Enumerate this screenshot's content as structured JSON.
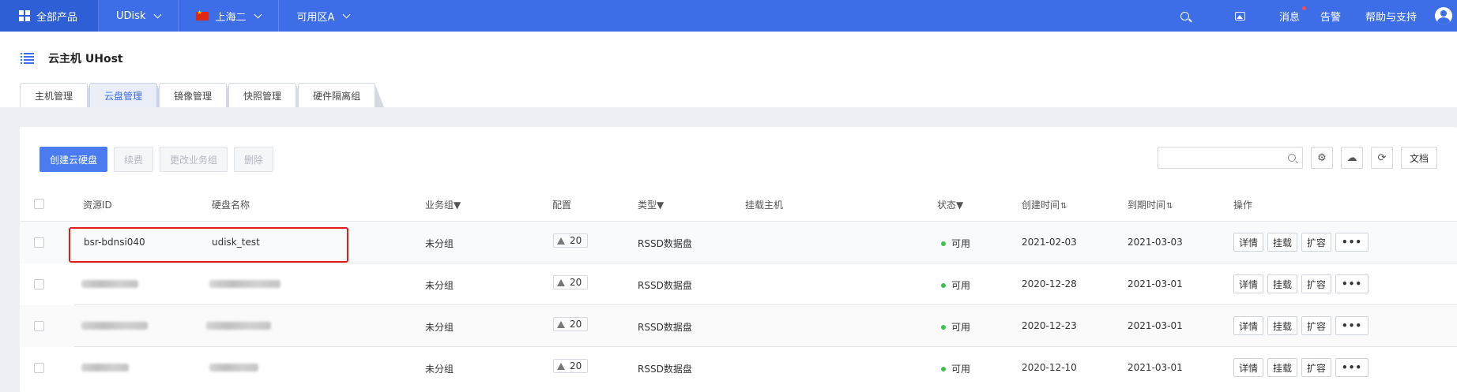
{
  "topbar": {
    "all_products": "全部产品",
    "product": "UDisk",
    "region": "上海二",
    "zone": "可用区A",
    "messages": "消息",
    "alerts": "告警",
    "help": "帮助与支持"
  },
  "header": {
    "title": "云主机 UHost",
    "tabs": [
      {
        "label": "主机管理"
      },
      {
        "label": "云盘管理"
      },
      {
        "label": "镜像管理"
      },
      {
        "label": "快照管理"
      },
      {
        "label": "硬件隔离组"
      }
    ]
  },
  "toolbar": {
    "create": "创建云硬盘",
    "renew": "续费",
    "change_group": "更改业务组",
    "delete": "删除",
    "docs": "文档"
  },
  "table": {
    "headers": {
      "resource_id": "资源ID",
      "disk_name": "硬盘名称",
      "business_group": "业务组▼",
      "config": "配置",
      "type": "类型▼",
      "host": "挂载主机",
      "status": "状态▼",
      "created": "创建时间",
      "expires": "到期时间",
      "ops": "操作"
    },
    "sort_glyph": "⇅",
    "rows": [
      {
        "id": "bsr-bdnsi040",
        "name": "udisk_test",
        "group": "未分组",
        "size": "20",
        "type": "RSSD数据盘",
        "status": "可用",
        "created": "2021-02-03",
        "expires": "2021-03-03"
      },
      {
        "id": "",
        "name": "",
        "group": "未分组",
        "size": "20",
        "type": "RSSD数据盘",
        "status": "可用",
        "created": "2020-12-28",
        "expires": "2021-03-01"
      },
      {
        "id": "",
        "name": "",
        "group": "未分组",
        "size": "20",
        "type": "RSSD数据盘",
        "status": "可用",
        "created": "2020-12-23",
        "expires": "2021-03-01"
      },
      {
        "id": "",
        "name": "",
        "group": "未分组",
        "size": "20",
        "type": "RSSD数据盘",
        "status": "可用",
        "created": "2020-12-10",
        "expires": "2021-03-01"
      }
    ],
    "ops": {
      "detail": "详情",
      "mount": "挂载",
      "expand": "扩容",
      "more": "•••"
    }
  },
  "colors": {
    "brand": "#3d6ee8",
    "status_ok": "#3cc34e",
    "highlight": "#e31b1b"
  }
}
